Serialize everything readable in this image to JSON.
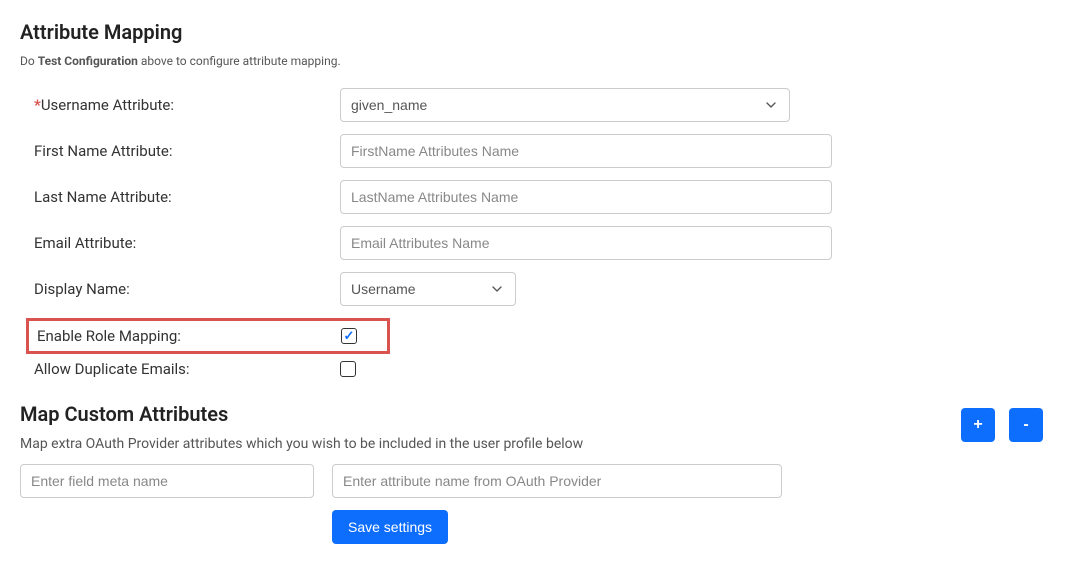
{
  "section1": {
    "title": "Attribute Mapping",
    "subtitle_prefix": "Do ",
    "subtitle_bold": "Test Configuration",
    "subtitle_suffix": " above to configure attribute mapping."
  },
  "fields": {
    "username": {
      "label": "Username Attribute:",
      "required": "*",
      "value": "given_name"
    },
    "firstname": {
      "label": "First Name Attribute:",
      "placeholder": "FirstName Attributes Name"
    },
    "lastname": {
      "label": "Last Name Attribute:",
      "placeholder": "LastName Attributes Name"
    },
    "email": {
      "label": "Email Attribute:",
      "placeholder": "Email Attributes Name"
    },
    "displayname": {
      "label": "Display Name:",
      "value": "Username"
    },
    "enablerole": {
      "label": "Enable Role Mapping:",
      "checked": true
    },
    "allowdup": {
      "label": "Allow Duplicate Emails:",
      "checked": false
    }
  },
  "section2": {
    "title": "Map Custom Attributes",
    "subtitle": "Map extra OAuth Provider attributes which you wish to be included in the user profile below",
    "add_btn": "+",
    "remove_btn": "-",
    "meta_placeholder": "Enter field meta name",
    "attr_placeholder": "Enter attribute name from OAuth Provider",
    "save": "Save settings"
  }
}
